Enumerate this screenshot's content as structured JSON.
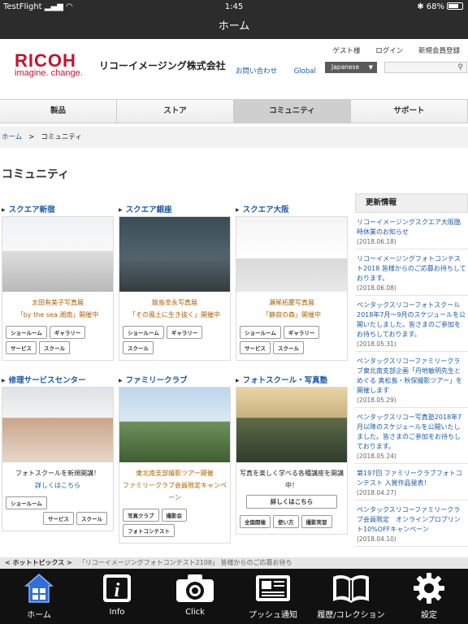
{
  "status": {
    "carrier": "TestFlight",
    "time": "1:45",
    "battery": "68%"
  },
  "navbar": {
    "title": "ホーム"
  },
  "header": {
    "logo": "RICOH",
    "tagline": "imagine. change.",
    "company": "リコーイメージング株式会社",
    "guest": "ゲスト様",
    "login": "ログイン",
    "register": "新規会員登録",
    "contact": "お問い合わせ",
    "global": "Global",
    "language": "Japanese"
  },
  "gnav": [
    "製品",
    "ストア",
    "コミュニティ",
    "サポート"
  ],
  "breadcrumb": {
    "home": "ホーム",
    "sep": ">",
    "current": "コミュニティ"
  },
  "page_title": "コミュニティ",
  "cards": [
    {
      "title": "スクエア新宿",
      "caption1": "太田有美子写真展",
      "caption2": "「by the sea 湘南」開催中",
      "tags": [
        "ショールーム",
        "ギャラリー",
        "サービス",
        "スクール"
      ]
    },
    {
      "title": "スクエア銀座",
      "caption1": "飯島幸永写真展",
      "caption2": "「その風土に生き抜く」開催中",
      "tags": [
        "ショールーム",
        "ギャラリー",
        "スクール"
      ]
    },
    {
      "title": "スクエア大阪",
      "caption1": "瀬尾拓慶写真展",
      "caption2": "「静寂の森」開催中",
      "tags": [
        "ショールーム",
        "ギャラリー",
        "サービス",
        "スクール"
      ]
    },
    {
      "title": "修理サービスセンター",
      "caption1": "フォトスクールを新規開講！",
      "link": "詳しくはこちら",
      "tags": [
        "ショールーム",
        "サービス",
        "スクール"
      ]
    },
    {
      "title": "ファミリークラブ",
      "caption1": "東北南支部撮影ツアー開催",
      "caption2": "ファミリークラブ会員限定キャンペーン",
      "tags": [
        "写真クラブ",
        "撮影会",
        "フォトコンテスト"
      ]
    },
    {
      "title": "フォトスクール・写真塾",
      "caption1": "写真を楽しく学べる各種講座を開講中！",
      "button": "詳しくはこちら",
      "tags": [
        "全国開催",
        "使い方",
        "撮影実習"
      ]
    }
  ],
  "news": {
    "heading": "更新情報",
    "items": [
      {
        "text": "リコーイメージングスクエア大阪臨時休業のお知らせ",
        "date": "(2018.06.18)"
      },
      {
        "text": "リコーイメージングフォトコンテスト2018 皆様からのご応募お待ちしております。",
        "date": "(2018.06.08)"
      },
      {
        "text": "ペンタックスリコーフォトスクール2018年7月～9月のスケジュールを公開いたしました。皆さまのご参加をお待ちしております。",
        "date": "(2018.05.31)"
      },
      {
        "text": "ペンタックスリコーファミリークラブ東北南支部企画「丹地敏明先生とめぐる 奥松島・秋保撮影ツアー」を開催します",
        "date": "(2018.05.29)"
      },
      {
        "text": "ペンタックスリコー写真塾2018年7月以降のスケジュールを公開いたしました。皆さまのご参加をお待ちしております。",
        "date": "(2018.05.24)"
      },
      {
        "text": "第197回 ファミリークラブフォトコンテスト 入賞作品発表！",
        "date": "(2018.04.27)"
      },
      {
        "text": "ペンタックスリコーファミリークラブ会員限定　オンラインプロプリント10%OFFキャンペーン",
        "date": "(2018.04.10)"
      }
    ]
  },
  "hot_topics": {
    "label": "< ホットトピックス >",
    "text": "「リコーイメージングフォトコンテスト2108」 皆様からのご応募お待ち"
  },
  "tabbar": [
    "ホーム",
    "Info",
    "Click",
    "プッシュ通知",
    "履歴/コレクション",
    "設定"
  ]
}
